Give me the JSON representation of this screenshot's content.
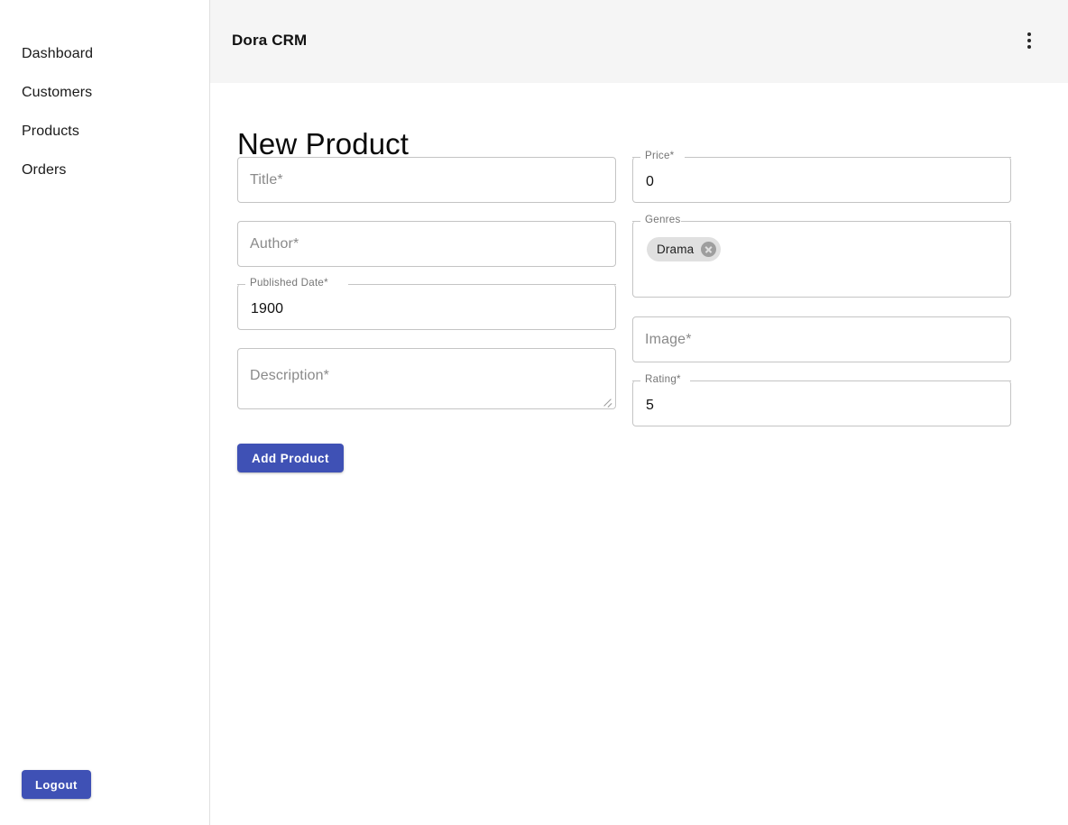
{
  "sidebar": {
    "items": [
      {
        "label": "Dashboard"
      },
      {
        "label": "Customers"
      },
      {
        "label": "Products"
      },
      {
        "label": "Orders"
      }
    ],
    "logout_label": "Logout"
  },
  "header": {
    "title": "Dora CRM",
    "menu_icon": "more-vertical-icon"
  },
  "main": {
    "page_title": "New Product",
    "submit_label": "Add Product",
    "fields": {
      "title": {
        "label": "Title*",
        "value": "",
        "placeholder": "Title*",
        "filled": false
      },
      "author": {
        "label": "Author*",
        "value": "",
        "placeholder": "Author*",
        "filled": false
      },
      "published_date": {
        "label": "Published Date*",
        "value": "1900",
        "placeholder": "Published Date*",
        "filled": true
      },
      "description": {
        "label": "Description*",
        "value": "",
        "placeholder": "Description*",
        "filled": false
      },
      "price": {
        "label": "Price*",
        "value": "0",
        "placeholder": "Price*",
        "filled": true
      },
      "genres": {
        "label": "Genres",
        "value": "",
        "placeholder": "Genres",
        "filled": true
      },
      "image": {
        "label": "Image*",
        "value": "",
        "placeholder": "Image*",
        "filled": false
      },
      "rating": {
        "label": "Rating*",
        "value": "5",
        "placeholder": "Rating*",
        "filled": true
      }
    },
    "genre_chips": [
      {
        "label": "Drama",
        "delete_icon": "cancel-circle-icon"
      }
    ]
  },
  "colors": {
    "primary": "#3f51b5",
    "appbar_bg": "#f5f5f5",
    "field_border": "#c4c4c4",
    "chip_bg": "#e0e0e0"
  }
}
